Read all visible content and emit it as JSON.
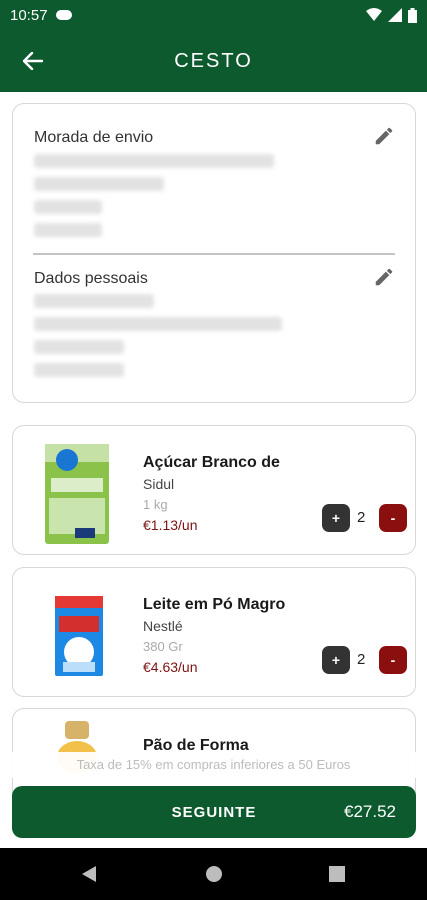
{
  "status_bar": {
    "time": "10:57"
  },
  "header": {
    "title": "CESTO"
  },
  "shipping": {
    "title": "Morada de envio"
  },
  "personal": {
    "title": "Dados pessoais"
  },
  "products": [
    {
      "name": "Açúcar Branco de",
      "brand": "Sidul",
      "size": "1 kg",
      "price": "€1.13/un",
      "quantity": "2",
      "plus": "+",
      "minus": "-"
    },
    {
      "name": "Leite em Pó Magro",
      "brand": "Nestlé",
      "size": "380 Gr",
      "price": "€4.63/un",
      "quantity": "2",
      "plus": "+",
      "minus": "-"
    },
    {
      "name": "Pão de Forma"
    }
  ],
  "footer": {
    "tax_note": "Taxa de 15% em compras inferiores a 50 Euros",
    "next_label": "SEGUINTE",
    "total": "€27.52"
  },
  "colors": {
    "brand_green": "#0d5a2e",
    "price_red": "#7b1414",
    "minus_red": "#8c0f0f"
  }
}
